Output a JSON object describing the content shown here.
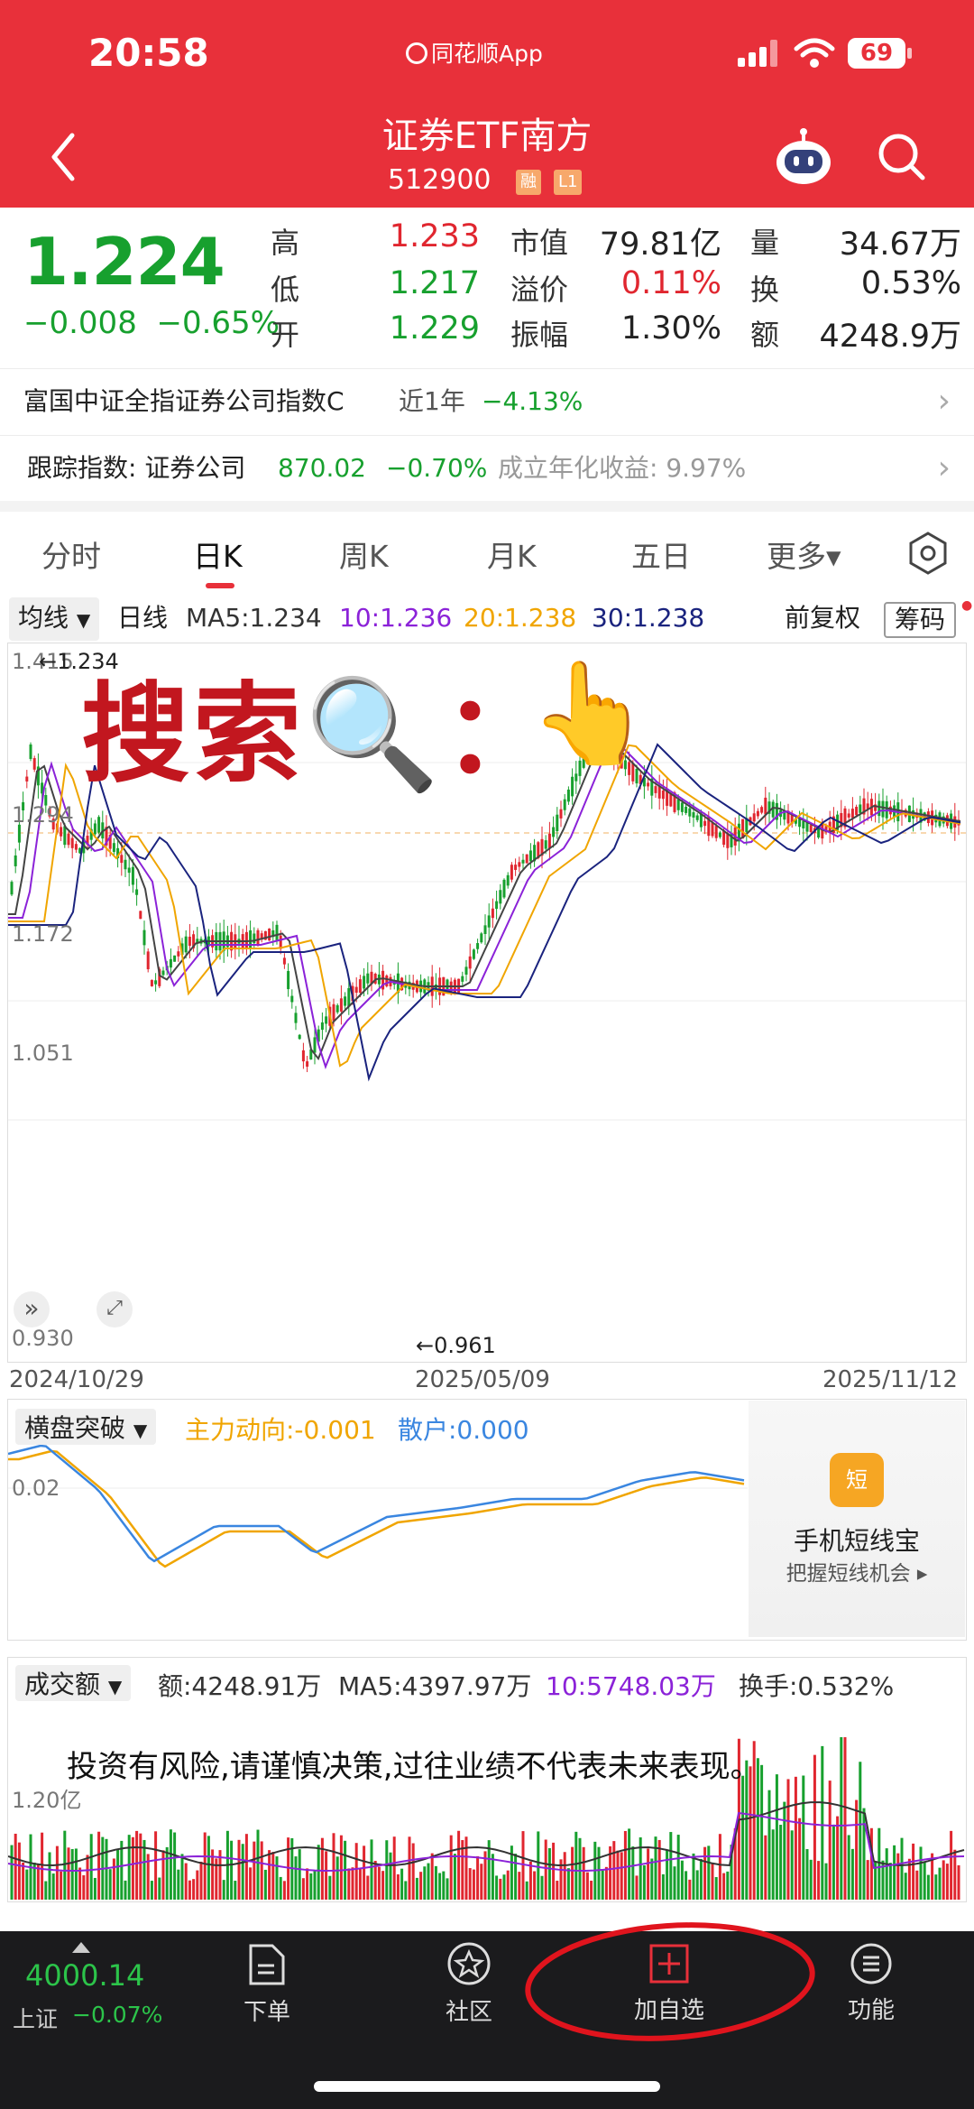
{
  "status_bar": {
    "time": "20:58",
    "app_name": "同花顺App",
    "battery": "69"
  },
  "header": {
    "title": "证券ETF南方",
    "code": "512900",
    "tags": [
      "融",
      "L1"
    ]
  },
  "quote": {
    "price": "1.224",
    "change": "−0.008",
    "change_pct": "−0.65%",
    "high_label": "高",
    "high": "1.233",
    "low_label": "低",
    "low": "1.217",
    "open_label": "开",
    "open": "1.229",
    "mktcap_label": "市值",
    "mktcap": "79.81亿",
    "premium_label": "溢价",
    "premium": "0.11%",
    "amplitude_label": "振幅",
    "amplitude": "1.30%",
    "volume_label": "量",
    "volume": "34.67万",
    "turnover_label": "换",
    "turnover": "0.53%",
    "amount_label": "额",
    "amount": "4248.9万"
  },
  "fund_row": {
    "name": "富国中证全指证券公司指数C",
    "period": "近1年",
    "ret": "−4.13%"
  },
  "tracking_row": {
    "label": "跟踪指数: 证券公司",
    "value": "870.02",
    "pct": "−0.70%",
    "annual": "成立年化收益: 9.97%"
  },
  "tabs": [
    "分时",
    "日K",
    "周K",
    "月K",
    "五日",
    "更多▾"
  ],
  "ma_row": {
    "type": "均线",
    "period": "日线",
    "ma5": "MA5:1.234",
    "ma10": "10:1.236",
    "ma20": "20:1.238",
    "ma30": "30:1.238",
    "adjust": "前复权",
    "chips": "筹码"
  },
  "kchart": {
    "high_label": "←1.234",
    "y_max": "1.415",
    "y_1": "1.294",
    "y_2": "1.172",
    "y_3": "1.051",
    "y_min": "0.930",
    "low_label": "←0.961",
    "dates": [
      "2024/10/29",
      "2025/05/09",
      "2025/11/12"
    ]
  },
  "indicator": {
    "name": "横盘突破",
    "main": "主力动向:-0.001",
    "retail": "散户:0.000",
    "y": "0.02"
  },
  "ad": {
    "title": "手机短线宝",
    "sub": "把握短线机会 ▸",
    "icon_text": "短"
  },
  "volume_panel": {
    "name": "成交额",
    "amount": "额:4248.91万",
    "ma5": "MA5:4397.97万",
    "ma10": "10:5748.03万",
    "turnover": "换手:0.532%",
    "y": "1.20亿"
  },
  "overlay": {
    "search_text": "搜索🔍：",
    "finger": "👆",
    "disclaimer": "投资有风险,请谨慎决策,过往业绩不代表未来表现。"
  },
  "bottom": {
    "index_value": "4000.14",
    "index_name": "上证",
    "index_pct": "−0.07%",
    "items": [
      "下单",
      "社区",
      "加自选",
      "功能"
    ]
  },
  "colors": {
    "brand_red": "#e8303a",
    "up": "#e0262f",
    "down": "#17a02e",
    "ma10": "#8b22d8",
    "ma20": "#f0a500",
    "ma30": "#1a237e"
  }
}
